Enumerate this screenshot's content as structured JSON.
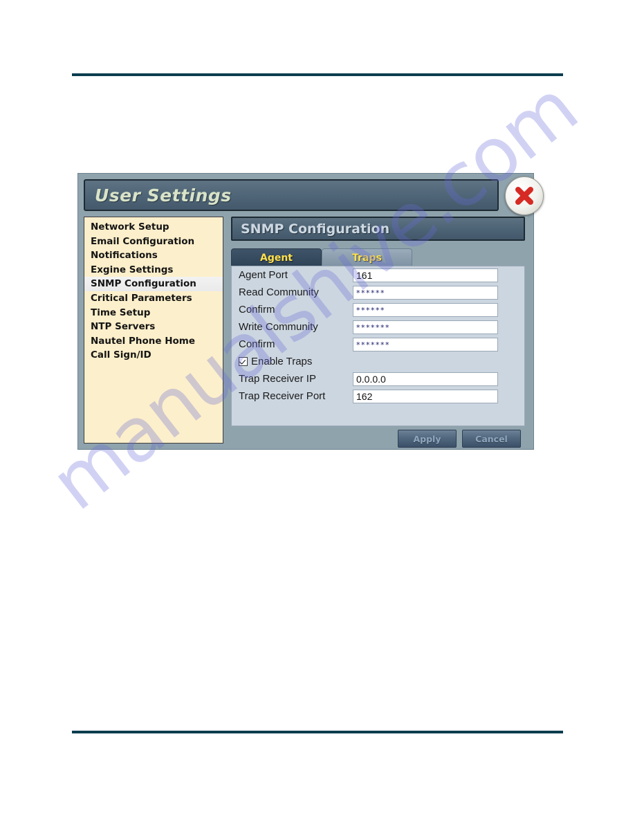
{
  "page": {
    "background": "#ffffff",
    "rule_color": "#0b3d4f",
    "watermark_text": "manualshive.com",
    "watermark_color": "#686ad6"
  },
  "dialog": {
    "title": "User Settings",
    "close_icon": "close-x-icon",
    "accent_title_color": "#d8e3c8",
    "frame_color": "#8fa3ad"
  },
  "sidebar": {
    "items": [
      {
        "label": "Network Setup",
        "selected": false
      },
      {
        "label": "Email Configuration",
        "selected": false
      },
      {
        "label": "Notifications",
        "selected": false
      },
      {
        "label": "Exgine Settings",
        "selected": false
      },
      {
        "label": "SNMP Configuration",
        "selected": true
      },
      {
        "label": "Critical Parameters",
        "selected": false
      },
      {
        "label": "Time Setup",
        "selected": false
      },
      {
        "label": "NTP Servers",
        "selected": false
      },
      {
        "label": "Nautel Phone Home",
        "selected": false
      },
      {
        "label": "Call Sign/ID",
        "selected": false
      }
    ]
  },
  "panel": {
    "section_title": "SNMP Configuration",
    "tabs": [
      {
        "label": "Agent",
        "active": true
      },
      {
        "label": "Traps",
        "active": false
      }
    ],
    "tab_text_color": "#ffe14d",
    "fields": [
      {
        "label": "Agent Port",
        "value": "161",
        "masked": false
      },
      {
        "label": "Read Community",
        "value": "******",
        "masked": true
      },
      {
        "label": "Confirm",
        "value": "******",
        "masked": true
      },
      {
        "label": "Write Community",
        "value": "*******",
        "masked": true
      },
      {
        "label": "Confirm",
        "value": "*******",
        "masked": true
      }
    ],
    "checkbox": {
      "label": "Enable Traps",
      "checked": true
    },
    "trap_fields": [
      {
        "label": "Trap Receiver IP",
        "value": "0.0.0.0",
        "masked": false
      },
      {
        "label": "Trap Receiver Port",
        "value": "162",
        "masked": false
      }
    ],
    "buttons": [
      {
        "label": "Apply"
      },
      {
        "label": "Cancel"
      }
    ]
  }
}
